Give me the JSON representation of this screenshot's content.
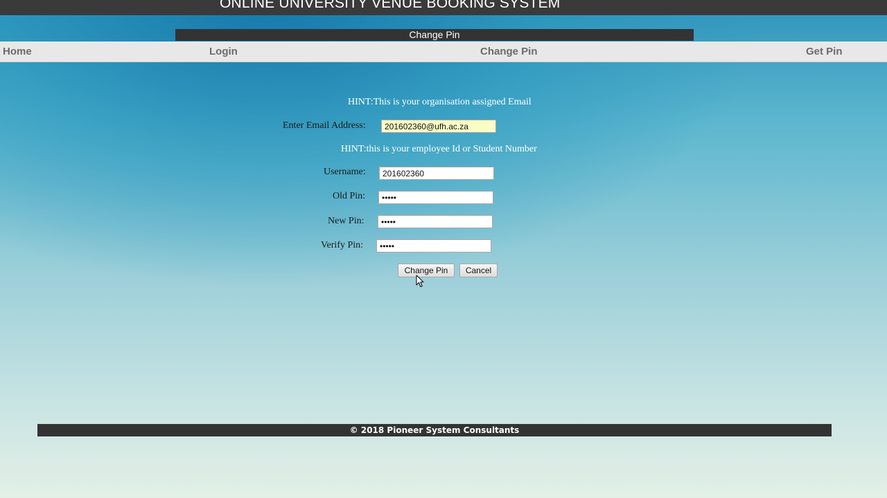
{
  "header": {
    "title": "ONLINE UNIVERSITY VENUE BOOKING SYSTEM",
    "page_heading": "Change Pin"
  },
  "nav": {
    "items": [
      {
        "label": "Home"
      },
      {
        "label": "Login"
      },
      {
        "label": "Change Pin"
      },
      {
        "label": "Get Pin"
      }
    ]
  },
  "form": {
    "email_hint": "HINT:This is your organisation assigned Email",
    "email_label": "Enter Email Address:",
    "email_value": "201602360@ufh.ac.za",
    "username_hint": "HINT:this is your employee Id or Student Number",
    "username_label": "Username:",
    "username_value": "201602360",
    "old_pin_label": "Old Pin:",
    "old_pin_value": "•••••",
    "new_pin_label": "New Pin:",
    "new_pin_value": "•••••",
    "verify_pin_label": "Verify Pin:",
    "verify_pin_value": "•••••",
    "submit_label": "Change Pin",
    "cancel_label": "Cancel"
  },
  "footer": {
    "copyright": "© 2018 Pioneer System Consultants"
  },
  "colors": {
    "bar_dark": "#333333",
    "nav_bg": "#e8e8e8",
    "nav_text": "#6b6b6b",
    "autofill_bg": "#fafcc6"
  }
}
